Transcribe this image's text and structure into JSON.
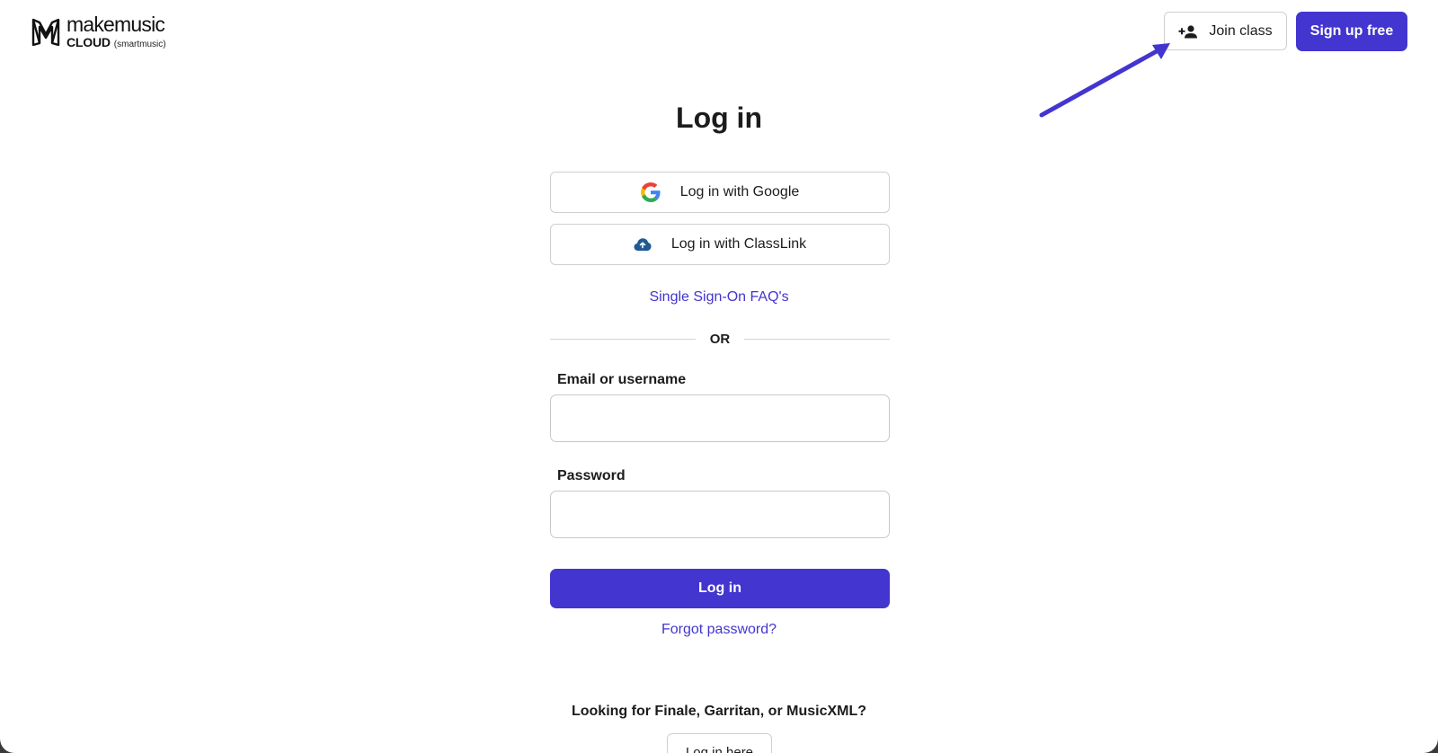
{
  "header": {
    "logo": {
      "brand": "makemusic",
      "product": "CLOUD",
      "sub": "(smartmusic)",
      "icon": "makemusic-logo-icon"
    },
    "join_class": {
      "label": "Join class",
      "icon": "person-add-icon"
    },
    "sign_up": {
      "label": "Sign up free"
    }
  },
  "main": {
    "title": "Log in",
    "google_button": {
      "label": "Log in with Google",
      "icon": "google-icon"
    },
    "classlink_button": {
      "label": "Log in with ClassLink",
      "icon": "classlink-icon"
    },
    "sso_faq_link": "Single Sign-On FAQ's",
    "divider_text": "OR",
    "email": {
      "label": "Email or username",
      "value": ""
    },
    "password": {
      "label": "Password",
      "value": ""
    },
    "login_button": "Log in",
    "forgot_link": "Forgot password?",
    "other_products": {
      "text": "Looking for Finale, Garritan, or MusicXML?",
      "button": "Log in here"
    }
  },
  "colors": {
    "accent": "#4335cf",
    "border": "#cfcfcf",
    "text": "#1c1c1c",
    "annotation_arrow": "#4335cf"
  }
}
